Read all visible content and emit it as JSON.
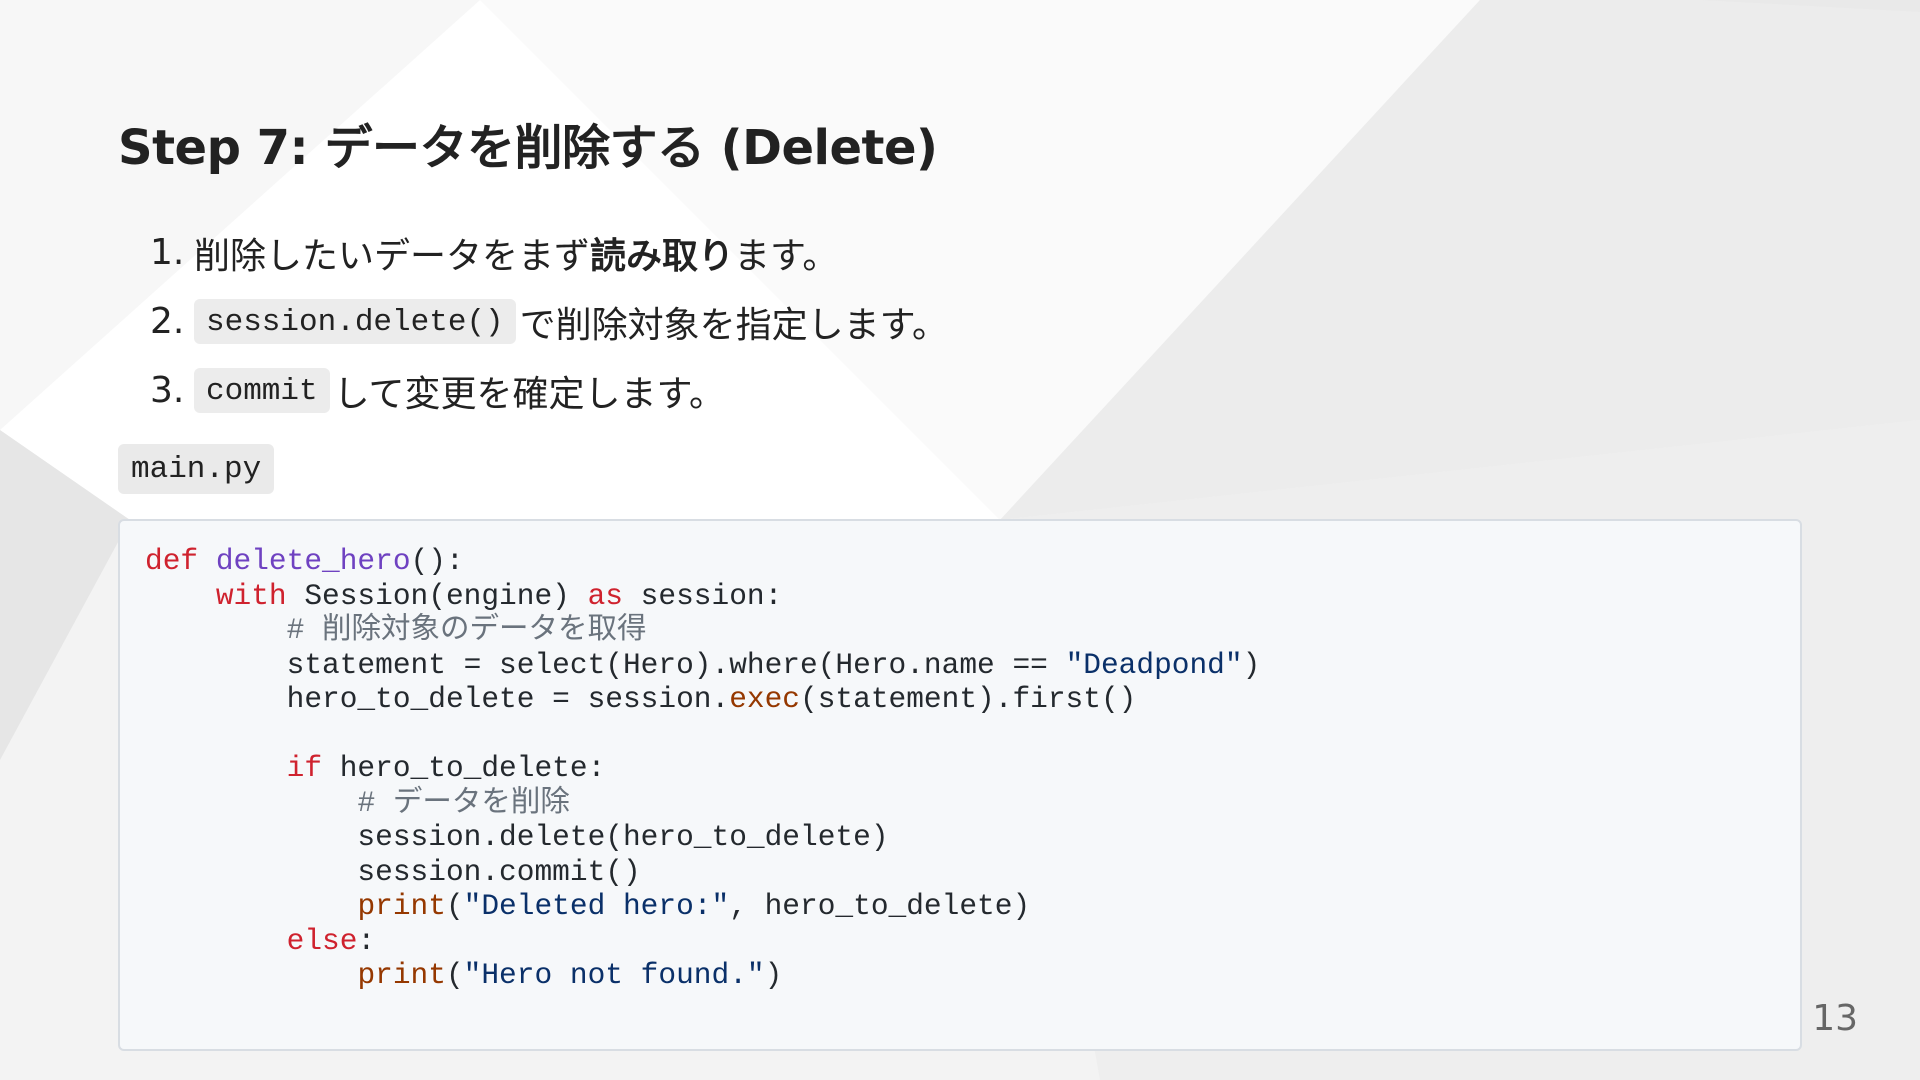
{
  "slide": {
    "title": "Step 7: データを削除する (Delete)",
    "steps": [
      {
        "number": "1.",
        "text_before": "削除したいデータをまず",
        "bold": "読み取り",
        "text_after": "ます。"
      },
      {
        "number": "2.",
        "code": "session.delete()",
        "text": "で削除対象を指定します。"
      },
      {
        "number": "3.",
        "code": "commit",
        "text": "して変更を確定します。"
      }
    ],
    "file_label": "main.py",
    "code_lines": [
      [
        {
          "t": "def",
          "c": "kw"
        },
        {
          "t": " "
        },
        {
          "t": "delete_hero",
          "c": "fn"
        },
        {
          "t": "():"
        }
      ],
      [
        {
          "t": "    "
        },
        {
          "t": "with",
          "c": "kw"
        },
        {
          "t": " Session(engine) "
        },
        {
          "t": "as",
          "c": "kw"
        },
        {
          "t": " session:"
        }
      ],
      [
        {
          "t": "        "
        },
        {
          "t": "# 削除対象のデータを取得",
          "c": "cm"
        }
      ],
      [
        {
          "t": "        statement = select(Hero).where(Hero.name == "
        },
        {
          "t": "\"Deadpond\"",
          "c": "str"
        },
        {
          "t": ")"
        }
      ],
      [
        {
          "t": "        hero_to_delete = session."
        },
        {
          "t": "exec",
          "c": "bi"
        },
        {
          "t": "(statement).first()"
        }
      ],
      [
        {
          "t": ""
        }
      ],
      [
        {
          "t": "        "
        },
        {
          "t": "if",
          "c": "kw"
        },
        {
          "t": " hero_to_delete:"
        }
      ],
      [
        {
          "t": "            "
        },
        {
          "t": "# データを削除",
          "c": "cm"
        }
      ],
      [
        {
          "t": "            session.delete(hero_to_delete)"
        }
      ],
      [
        {
          "t": "            session.commit()"
        }
      ],
      [
        {
          "t": "            "
        },
        {
          "t": "print",
          "c": "bi"
        },
        {
          "t": "("
        },
        {
          "t": "\"Deleted hero:\"",
          "c": "str"
        },
        {
          "t": ", hero_to_delete)"
        }
      ],
      [
        {
          "t": "        "
        },
        {
          "t": "else",
          "c": "kw"
        },
        {
          "t": ":"
        }
      ],
      [
        {
          "t": "            "
        },
        {
          "t": "print",
          "c": "bi"
        },
        {
          "t": "("
        },
        {
          "t": "\"Hero not found.\"",
          "c": "str"
        },
        {
          "t": ")"
        }
      ]
    ],
    "page_number": "13"
  }
}
